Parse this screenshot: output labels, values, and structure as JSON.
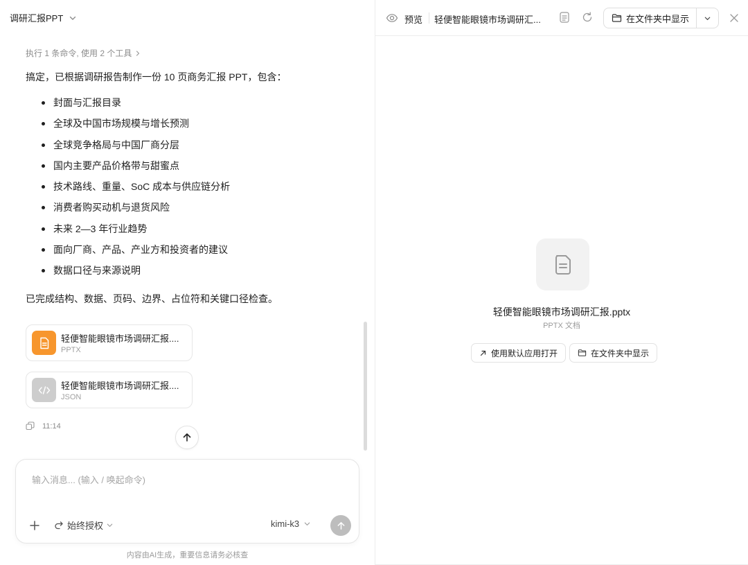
{
  "conversation": {
    "title": "调研汇报PPT"
  },
  "message": {
    "tools_summary": "执行 1 条命令, 使用 2 个工具",
    "intro": "搞定，已根据调研报告制作一份 10 页商务汇报 PPT，包含：",
    "bullets": [
      "封面与汇报目录",
      "全球及中国市场规模与增长预测",
      "全球竞争格局与中国厂商分层",
      "国内主要产品价格带与甜蜜点",
      "技术路线、重量、SoC 成本与供应链分析",
      "消费者购买动机与退货风险",
      "未来 2—3 年行业趋势",
      "面向厂商、产品、产业方和投资者的建议",
      "数据口径与来源说明"
    ],
    "outro": "已完成结构、数据、页码、边界、占位符和关键口径检查。",
    "files": [
      {
        "name": "轻便智能眼镜市场调研汇报....",
        "type": "PPTX",
        "icon": "document-icon",
        "color": "#f7962d"
      },
      {
        "name": "轻便智能眼镜市场调研汇报....",
        "type": "JSON",
        "icon": "code-icon",
        "color": "#cdcdcd"
      }
    ],
    "time": "11:14"
  },
  "composer": {
    "placeholder": "输入消息... (输入 / 唤起命令)",
    "permission": "始终授权",
    "model": "kimi-k3"
  },
  "disclaimer": "内容由AI生成，重要信息请务必核查",
  "preview": {
    "label": "预览",
    "doc_title": "轻便智能眼镜市场调研汇...",
    "show_in_folder": "在文件夹中显示",
    "file_name": "轻便智能眼镜市场调研汇报.pptx",
    "file_type": "PPTX 文档",
    "open_default": "使用默认应用打开",
    "show_in_folder_2": "在文件夹中显示"
  },
  "colors": {
    "accent_file": "#f7962d",
    "send_disabled": "#bdbdbd"
  }
}
